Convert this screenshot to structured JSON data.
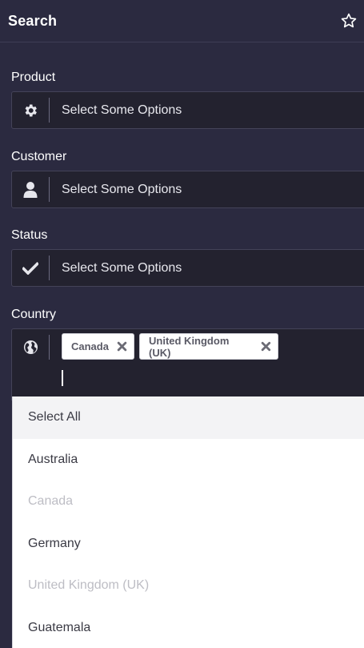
{
  "header": {
    "title": "Search",
    "star_icon": "star-outline-icon"
  },
  "fields": {
    "product": {
      "label": "Product",
      "placeholder": "Select Some Options",
      "icon": "gear-icon"
    },
    "customer": {
      "label": "Customer",
      "placeholder": "Select Some Options",
      "icon": "user-icon"
    },
    "status": {
      "label": "Status",
      "placeholder": "Select Some Options",
      "icon": "check-icon"
    },
    "country": {
      "label": "Country",
      "icon": "globe-icon",
      "selected": [
        "Canada",
        "United Kingdom (UK)"
      ]
    }
  },
  "dropdown": {
    "options": [
      {
        "label": "Select All",
        "state": "highlighted"
      },
      {
        "label": "Australia",
        "state": "normal"
      },
      {
        "label": "Canada",
        "state": "disabled"
      },
      {
        "label": "Germany",
        "state": "normal"
      },
      {
        "label": "United Kingdom (UK)",
        "state": "disabled"
      },
      {
        "label": "Guatemala",
        "state": "normal"
      }
    ]
  },
  "colors": {
    "background": "#2b2a40",
    "field_background": "#23222f",
    "chip_background": "#ffffff",
    "disabled_text": "#bdbdc4"
  }
}
